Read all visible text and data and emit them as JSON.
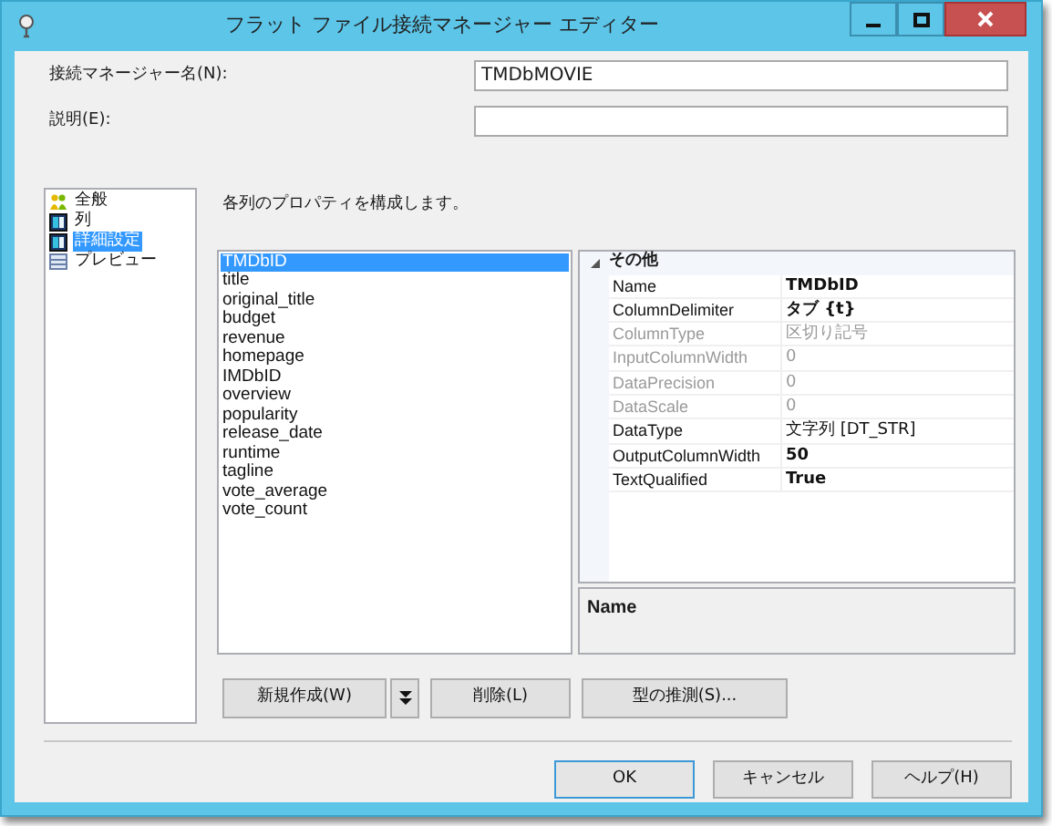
{
  "window": {
    "title": "フラット ファイル接続マネージャー エディター"
  },
  "fields": [
    {
      "label": "接続マネージャー名(N):",
      "value": "TMDbMOVIE"
    },
    {
      "label": "説明(E):"
    }
  ],
  "nav": [
    {
      "label": "全般",
      "kind": "general",
      "selected": false
    },
    {
      "label": "列",
      "kind": "columns",
      "selected": false
    },
    {
      "label": "詳細設定",
      "kind": "columns",
      "selected": true
    },
    {
      "label": "プレビュー",
      "kind": "preview",
      "selected": false
    }
  ],
  "heading": "各列のプロパティを構成します。",
  "columns": [
    {
      "label": "TMDbID",
      "selected": true
    },
    {
      "label": "title",
      "selected": false
    },
    {
      "label": "original_title",
      "selected": false
    },
    {
      "label": "budget",
      "selected": false
    },
    {
      "label": "revenue",
      "selected": false
    },
    {
      "label": "homepage",
      "selected": false
    },
    {
      "label": "IMDbID",
      "selected": false
    },
    {
      "label": "overview",
      "selected": false
    },
    {
      "label": "popularity",
      "selected": false
    },
    {
      "label": "release_date",
      "selected": false
    },
    {
      "label": "runtime",
      "selected": false
    },
    {
      "label": "tagline",
      "selected": false
    },
    {
      "label": "vote_average",
      "selected": false
    },
    {
      "label": "vote_count",
      "selected": false
    }
  ],
  "properties": {
    "category": "その他",
    "expanded": true,
    "rows": [
      {
        "name": "Name",
        "value": "TMDbID",
        "disabled": false,
        "modified": true
      },
      {
        "name": "ColumnDelimiter",
        "value": "タブ {t}",
        "disabled": false,
        "modified": true
      },
      {
        "name": "ColumnType",
        "value": "区切り記号",
        "disabled": true,
        "modified": false
      },
      {
        "name": "InputColumnWidth",
        "value": "0",
        "disabled": true,
        "modified": false
      },
      {
        "name": "DataPrecision",
        "value": "0",
        "disabled": true,
        "modified": false
      },
      {
        "name": "DataScale",
        "value": "0",
        "disabled": true,
        "modified": false
      },
      {
        "name": "DataType",
        "value": "文字列 [DT_STR]",
        "disabled": false,
        "modified": false
      },
      {
        "name": "OutputColumnWidth",
        "value": "50",
        "disabled": false,
        "modified": true
      },
      {
        "name": "TextQualified",
        "value": "True",
        "disabled": false,
        "modified": true
      }
    ],
    "description_title": "Name"
  },
  "column_buttons": [
    {
      "label": "新規作成(W)",
      "kind": "split"
    },
    {
      "label": "削除(L)",
      "kind": "plain"
    },
    {
      "label": "型の推測(S)...",
      "kind": "plain"
    }
  ],
  "buttons": [
    {
      "label": "OK",
      "default": true
    },
    {
      "label": "キャンセル",
      "default": false
    },
    {
      "label": "ヘルプ(H)",
      "default": false
    }
  ]
}
